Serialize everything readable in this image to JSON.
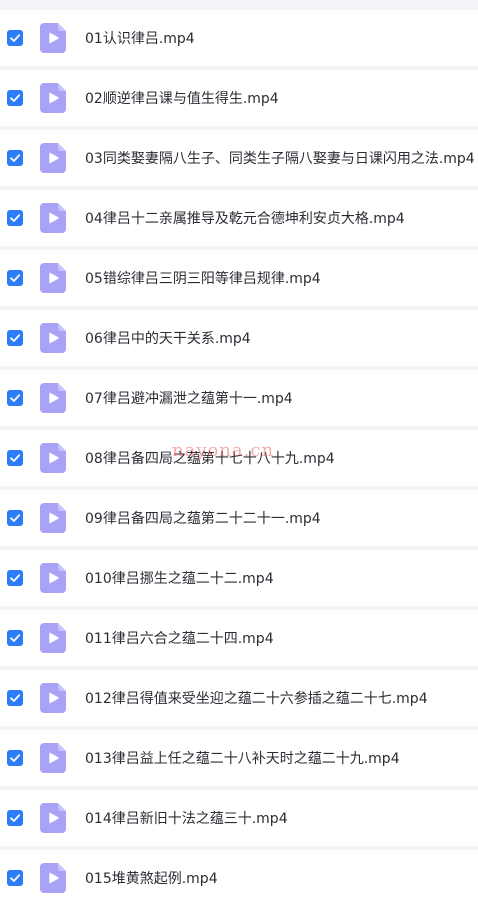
{
  "colors": {
    "checkbox": "#2b7cf6",
    "file_icon": "#a9a3f5",
    "file_icon_fold": "#c9c4fa",
    "text": "#2a2d33",
    "row_bg": "#ffffff",
    "gap_bg": "#f3f4f8",
    "watermark": "#e84848"
  },
  "watermark": "nayona.cn",
  "files": [
    {
      "name": "01认识律吕.mp4",
      "checked": true,
      "icon": "video-file-icon"
    },
    {
      "name": "02顺逆律吕课与值生得生.mp4",
      "checked": true,
      "icon": "video-file-icon"
    },
    {
      "name": "03同类娶妻隔八生子、同类生子隔八娶妻与日课闪用之法.mp4",
      "checked": true,
      "icon": "video-file-icon"
    },
    {
      "name": "04律吕十二亲属推导及乾元合德坤利安贞大格.mp4",
      "checked": true,
      "icon": "video-file-icon"
    },
    {
      "name": "05错综律吕三阴三阳等律吕规律.mp4",
      "checked": true,
      "icon": "video-file-icon"
    },
    {
      "name": "06律吕中的天干关系.mp4",
      "checked": true,
      "icon": "video-file-icon"
    },
    {
      "name": "07律吕避冲漏泄之蕴第十一.mp4",
      "checked": true,
      "icon": "video-file-icon"
    },
    {
      "name": "08律吕备四局之蕴第十七十八十九.mp4",
      "checked": true,
      "icon": "video-file-icon"
    },
    {
      "name": "09律吕备四局之蕴第二十二十一.mp4",
      "checked": true,
      "icon": "video-file-icon"
    },
    {
      "name": "010律吕挪生之蕴二十二.mp4",
      "checked": true,
      "icon": "video-file-icon"
    },
    {
      "name": "011律吕六合之蕴二十四.mp4",
      "checked": true,
      "icon": "video-file-icon"
    },
    {
      "name": "012律吕得值来受坐迎之蕴二十六参插之蕴二十七.mp4",
      "checked": true,
      "icon": "video-file-icon"
    },
    {
      "name": "013律吕益上任之蕴二十八补天时之蕴二十九.mp4",
      "checked": true,
      "icon": "video-file-icon"
    },
    {
      "name": "014律吕新旧十法之蕴三十.mp4",
      "checked": true,
      "icon": "video-file-icon"
    },
    {
      "name": "015堆黄煞起例.mp4",
      "checked": true,
      "icon": "video-file-icon"
    }
  ]
}
